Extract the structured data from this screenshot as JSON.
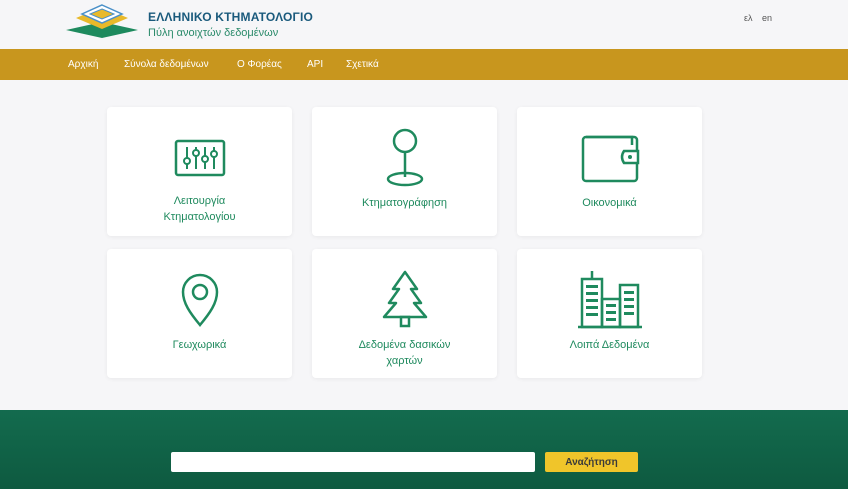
{
  "header": {
    "title": "ΕΛΛΗΝΙΚΟ ΚΤΗΜΑΤΟΛΟΓΙΟ",
    "subtitle": "Πύλη ανοιχτών δεδομένων",
    "lang_el": "ελ",
    "lang_en": "en"
  },
  "nav": {
    "items": [
      {
        "label": "Αρχική"
      },
      {
        "label": "Σύνολα δεδομένων"
      },
      {
        "label": "Ο Φορέας"
      },
      {
        "label": "API"
      },
      {
        "label": "Σχετικά"
      }
    ]
  },
  "cards": [
    {
      "label_line1": "Λειτουργία",
      "label_line2": "Κτηματολογίου",
      "icon": "sliders-icon"
    },
    {
      "label_line1": "Κτηματογράφηση",
      "label_line2": "",
      "icon": "map-pin-icon"
    },
    {
      "label_line1": "Οικονομικά",
      "label_line2": "",
      "icon": "wallet-icon"
    },
    {
      "label_line1": "Γεωχωρικά",
      "label_line2": "",
      "icon": "location-marker-icon"
    },
    {
      "label_line1": "Δεδομένα δασικών",
      "label_line2": "χαρτών",
      "icon": "tree-icon"
    },
    {
      "label_line1": "Λοιπά Δεδομένα",
      "label_line2": "",
      "icon": "buildings-icon"
    }
  ],
  "search": {
    "placeholder": "",
    "button_label": "Αναζήτηση"
  },
  "colors": {
    "nav_bg": "#c8961e",
    "accent_green": "#1f8a5e",
    "footer_green": "#136b4e",
    "search_button": "#f0c52a"
  }
}
